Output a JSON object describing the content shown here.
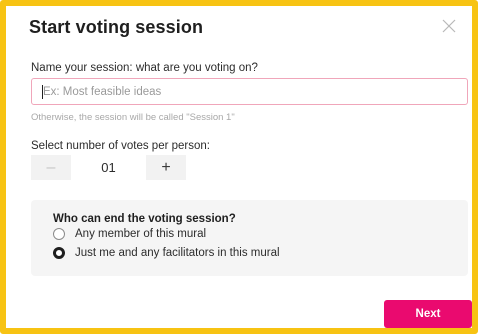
{
  "dialog": {
    "title": "Start voting session",
    "close_icon": "close-icon"
  },
  "name_field": {
    "label": "Name your session: what are you voting on?",
    "placeholder": "Ex: Most feasible ideas",
    "value": "",
    "hint": "Otherwise, the session will be called \"Session 1\""
  },
  "votes": {
    "label": "Select number of votes per person:",
    "decrement_label": "–",
    "increment_label": "+",
    "value": "01"
  },
  "end_session": {
    "heading": "Who can end the voting session?",
    "options": [
      {
        "label": "Any member of this mural",
        "selected": false
      },
      {
        "label": "Just me and any facilitators in this mural",
        "selected": true
      }
    ]
  },
  "footer": {
    "next_label": "Next"
  },
  "colors": {
    "frame_border": "#f7c313",
    "input_border": "#f0a6ba",
    "primary_button": "#ea0a6f",
    "panel_background": "#f5f5f5"
  }
}
